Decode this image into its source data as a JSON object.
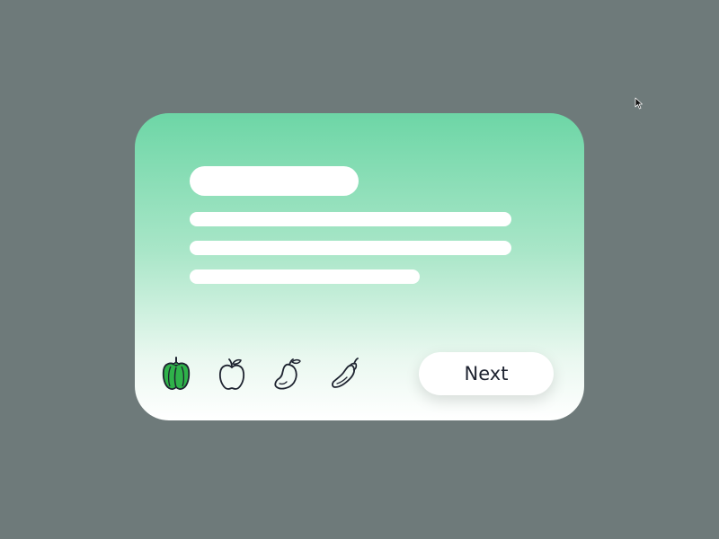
{
  "theme": {
    "page_background": "#6e7a7a",
    "card_gradient_top": "#6dd6a6",
    "card_gradient_bottom": "#ffffff",
    "selected_icon_fill": "#2fb24a",
    "icon_stroke": "#1e2330"
  },
  "card": {
    "icons": [
      {
        "name": "bell-pepper-icon",
        "selected": true
      },
      {
        "name": "apple-icon",
        "selected": false
      },
      {
        "name": "mango-icon",
        "selected": false
      },
      {
        "name": "eggplant-icon",
        "selected": false
      }
    ],
    "next_label": "Next"
  }
}
